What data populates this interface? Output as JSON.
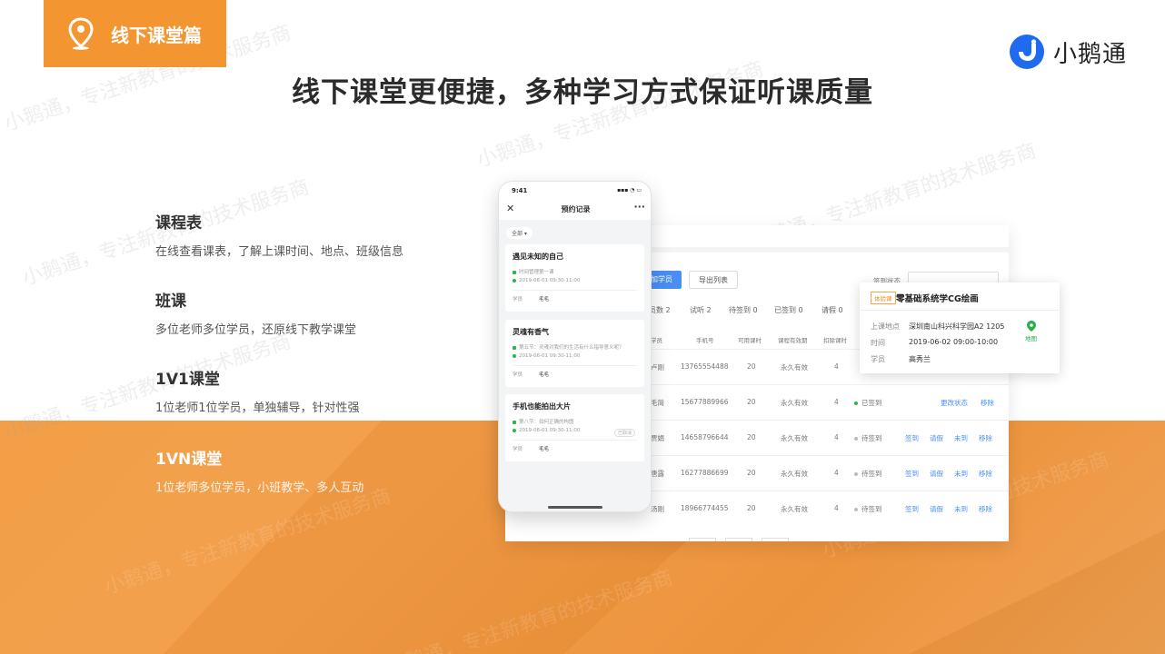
{
  "section_tag": {
    "label": "线下课堂篇",
    "icon": "map-pin-icon"
  },
  "brand": {
    "name": "小鹅通",
    "icon": "brand-logo"
  },
  "headline": "线下课堂更便捷，多种学习方式保证听课质量",
  "features": [
    {
      "title": "课程表",
      "desc": "在线查看课表，了解上课时间、地点、班级信息"
    },
    {
      "title": "班课",
      "desc": "多位老师多位学员，还原线下教学课堂"
    },
    {
      "title": "1V1课堂",
      "desc": "1位老师1位学员，单独辅导，针对性强"
    },
    {
      "title": "1VN课堂",
      "desc": "1位老师多位学员，小班教学、多人互动"
    }
  ],
  "watermark": "小鹅通，专注新教育的技术服务商",
  "phone": {
    "time": "9:41",
    "nav_title": "预约记录",
    "close": "✕",
    "more": "···",
    "filter_chip": "全部 ▾",
    "cards": [
      {
        "title": "遇见未知的自己",
        "line1": "时间管理第一课",
        "line2": "2019-06-01 09:30-11:00",
        "foot_label": "学员",
        "foot_name": "毛毛",
        "badge": ""
      },
      {
        "title": "灵魂有香气",
        "line1": "第五节：灵魂对我们的生活有什么指导意义呢？",
        "line2": "2019-06-01 09:30-11:00",
        "foot_label": "学员",
        "foot_name": "毛毛",
        "badge": ""
      },
      {
        "title": "手机也能拍出大片",
        "line1": "第八节：如何正确的构图",
        "line2": "2019-06-01 09:30-11:00",
        "foot_label": "学员",
        "foot_name": "毛毛",
        "badge": "已取消"
      }
    ]
  },
  "admin": {
    "add_button": "加学员",
    "export_button": "导出列表",
    "filter_label": "签到状态",
    "stats": [
      "员数 2",
      "试听 2",
      "待签到 0",
      "已签到 0",
      "请假 0"
    ],
    "headers": [
      "学员",
      "手机号",
      "可用课时",
      "课程有效期",
      "扣除课时"
    ],
    "rows": [
      {
        "name": "卢刚",
        "phone": "13765554488",
        "hours": "20",
        "validity": "永久有效",
        "deduct": "4",
        "status": "",
        "actions": []
      },
      {
        "name": "毛简",
        "phone": "15677889966",
        "hours": "20",
        "validity": "永久有效",
        "deduct": "4",
        "status": "已签到",
        "actions": [
          "更改状态",
          "移除"
        ]
      },
      {
        "name": "贾娟",
        "phone": "14658796644",
        "hours": "20",
        "validity": "永久有效",
        "deduct": "4",
        "status": "待签到",
        "actions": [
          "签到",
          "请假",
          "未到",
          "移除"
        ]
      },
      {
        "name": "唐露",
        "phone": "16277886699",
        "hours": "20",
        "validity": "永久有效",
        "deduct": "4",
        "status": "待签到",
        "actions": [
          "签到",
          "请假",
          "未到",
          "移除"
        ]
      },
      {
        "name": "汤刚",
        "phone": "18966774455",
        "hours": "20",
        "validity": "永久有效",
        "deduct": "4",
        "status": "待签到",
        "actions": [
          "签到",
          "请假",
          "未到",
          "移除"
        ]
      }
    ],
    "status_colors": {
      "signed": "#2fb34d",
      "pending": "#bbbbbb"
    }
  },
  "popup": {
    "tag": "体验课",
    "title": "零基础系统学CG绘画",
    "location_label": "上课地点",
    "location": "深圳南山科兴科学园A2 1205",
    "time_label": "时间",
    "time": "2019-06-02 09:00-10:00",
    "student_label": "学员",
    "student": "高秀兰",
    "map_label": "地图"
  },
  "colors": {
    "accent": "#f39531",
    "primary_blue": "#4a8ef5"
  }
}
